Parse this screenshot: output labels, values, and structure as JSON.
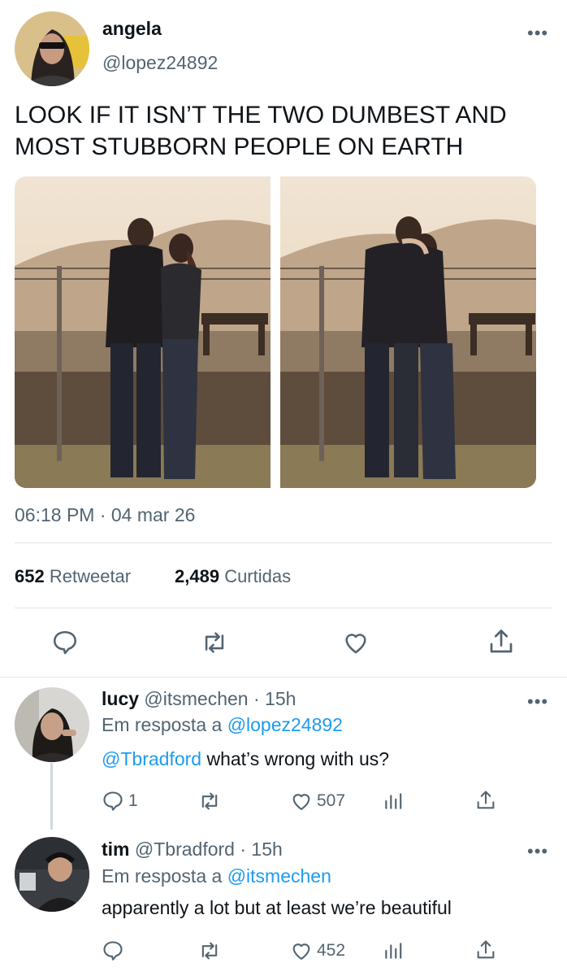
{
  "tweet": {
    "display_name": "angela",
    "handle": "@lopez24892",
    "text_line1": "LOOK IF IT ISN’T THE TWO DUMBEST AND",
    "text_line2": "MOST STUBBORN PEOPLE ON EARTH",
    "timestamp": "06:18 PM · 04 mar 26",
    "retweets_count": "652",
    "retweets_label": "Retweetar",
    "likes_count": "2,489",
    "likes_label": "Curtidas",
    "more_icon": "more-horizontal-icon"
  },
  "replies": [
    {
      "name": "lucy",
      "handle": "@itsmechen",
      "time": "· 15h",
      "reply_prefix": "Em resposta a",
      "reply_to": "@lopez24892",
      "mention": "@Tbradford",
      "text": "what’s wrong with us?",
      "reply_count": "1",
      "like_count": "507"
    },
    {
      "name": "tim",
      "handle": "@Tbradford",
      "time": "· 15h",
      "reply_prefix": "Em resposta a",
      "reply_to": "@itsmechen",
      "text": "apparently a lot but at least we’re beautiful",
      "like_count": "452"
    }
  ],
  "colors": {
    "link": "#1d9bf0",
    "muted": "#536471",
    "divider": "#e1e5e8",
    "text": "#0f1419"
  }
}
